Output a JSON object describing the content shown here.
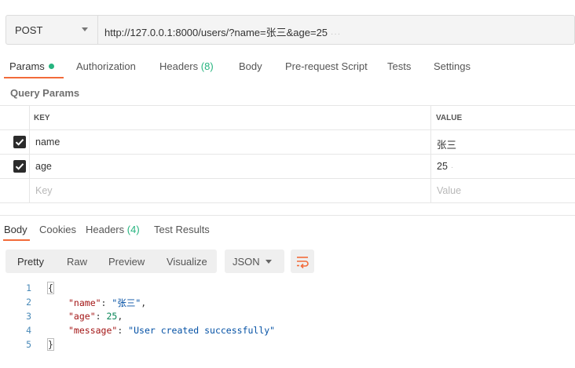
{
  "request": {
    "method": "POST",
    "url": "http://127.0.0.1:8000/users/?name=张三&age=25"
  },
  "tabs": [
    {
      "label": "Params"
    },
    {
      "label": "Authorization"
    },
    {
      "label": "Headers",
      "count": "(8)"
    },
    {
      "label": "Body"
    },
    {
      "label": "Pre-request Script"
    },
    {
      "label": "Tests"
    },
    {
      "label": "Settings"
    }
  ],
  "query_params": {
    "title": "Query Params",
    "headers": {
      "key": "KEY",
      "value": "VALUE"
    },
    "rows": [
      {
        "key": "name",
        "value": "张三",
        "checked": true
      },
      {
        "key": "age",
        "value": "25",
        "checked": true
      }
    ],
    "placeholder": {
      "key": "Key",
      "value": "Value"
    }
  },
  "response_tabs": [
    {
      "label": "Body"
    },
    {
      "label": "Cookies"
    },
    {
      "label": "Headers",
      "count": "(4)"
    },
    {
      "label": "Test Results"
    }
  ],
  "view_modes": [
    "Pretty",
    "Raw",
    "Preview",
    "Visualize"
  ],
  "format": "JSON",
  "body_lines": {
    "numbers": [
      "1",
      "2",
      "3",
      "4",
      "5"
    ],
    "open": "{",
    "close": "}",
    "fields": [
      {
        "key": "\"name\"",
        "value": "\"张三\"",
        "suffix": ","
      },
      {
        "key": "\"age\"",
        "value": "25",
        "suffix": ","
      },
      {
        "key": "\"message\"",
        "value": "\"User created successfully\"",
        "suffix": ""
      }
    ]
  },
  "colors": {
    "accent": "#f26b3a",
    "green": "#26b47f"
  }
}
